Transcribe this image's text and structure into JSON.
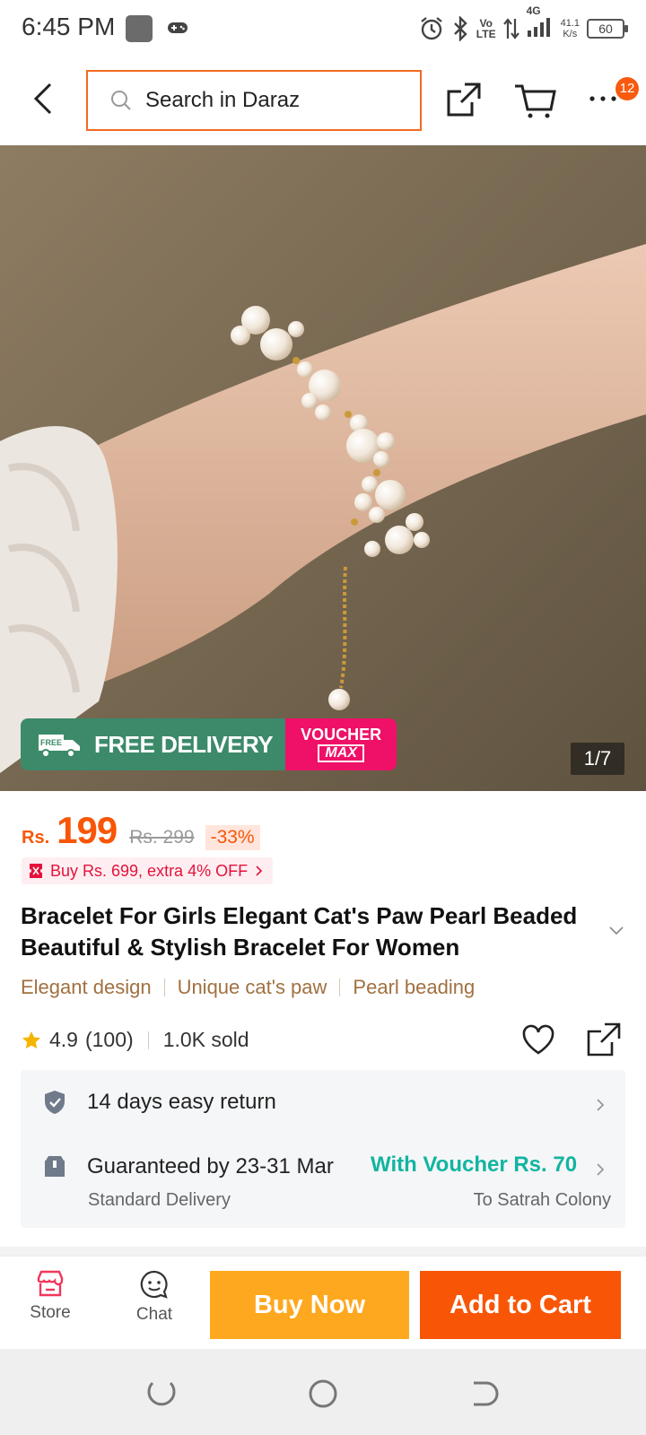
{
  "status_bar": {
    "time": "6:45 PM",
    "volte": "Vo\nLTE",
    "network": "4G",
    "speed": "41.1\nK/s",
    "battery": "60"
  },
  "header": {
    "search_placeholder": "Search in Daraz",
    "cart_badge": "12"
  },
  "gallery": {
    "free_delivery_label": "FREE DELIVERY",
    "free_truck_label": "FREE",
    "voucher_line1": "VOUCHER",
    "voucher_line2": "MAX",
    "counter": "1/7"
  },
  "price": {
    "currency": "Rs.",
    "current": "199",
    "original": "Rs. 299",
    "discount": "-33%"
  },
  "promo": {
    "text": "Buy Rs. 699, extra 4% OFF"
  },
  "product": {
    "title": "Bracelet For Girls Elegant Cat's Paw Pearl Beaded Beautiful & Stylish Bracelet For Women",
    "tags": [
      "Elegant design",
      "Unique cat's paw",
      "Pearl beading"
    ],
    "rating": "4.9",
    "reviews": "(100)",
    "sold": "1.0K sold"
  },
  "service": {
    "return_text": "14 days easy return",
    "guarantee_text": "Guaranteed by 23-31 Mar",
    "voucher_text": "With Voucher Rs. 70",
    "delivery_type": "Standard Delivery",
    "delivery_location": "To Satrah Colony"
  },
  "actions": {
    "store_label": "Store",
    "chat_label": "Chat",
    "buy_now_label": "Buy Now",
    "add_to_cart_label": "Add to Cart"
  },
  "colors": {
    "brand_orange": "#f85606",
    "buy_yellow": "#fea81f",
    "voucher_teal": "#12b5a0",
    "free_green": "#3c8a6a",
    "voucher_pink": "#ee1167"
  }
}
